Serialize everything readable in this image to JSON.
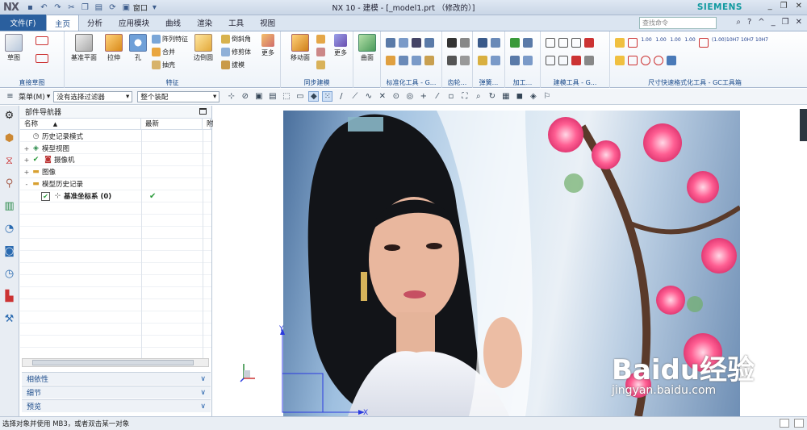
{
  "app": {
    "logo": "NX",
    "title": "NX 10 - 建模 - [_model1.prt （修改的）]",
    "brand": "SIEMENS",
    "window_menu": "窗口"
  },
  "ribbon_tabs": {
    "file": "文件(F)",
    "items": [
      "主页",
      "分析",
      "应用模块",
      "曲线",
      "渲染",
      "工具",
      "视图"
    ],
    "active": "主页",
    "search_placeholder": "查找命令"
  },
  "ribbon": {
    "direct_sketch": {
      "label": "直接草图",
      "sketch": "草图"
    },
    "feature": {
      "label": "特征",
      "datum_plane": "基准平面",
      "extrude": "拉伸",
      "hole": "孔",
      "pattern": "阵列特征",
      "unite": "合并",
      "shell": "抽壳",
      "edge_blend": "边倒圆",
      "chamfer": "倒斜角",
      "trim_body": "修剪体",
      "draft": "拔模",
      "more": "更多"
    },
    "sync": {
      "label": "同步建模",
      "move_face": "移动面",
      "more": "更多"
    },
    "surface": {
      "label": "",
      "surface": "曲面"
    },
    "group_labels": [
      "标准化工具 - G...",
      "齿轮...",
      "弹簧...",
      "加工...",
      "建模工具 - G...",
      "尺寸快速格式化工具 - GC工具箱"
    ]
  },
  "toolbar": {
    "menu": "菜单(M)",
    "filter": "没有选择过滤器",
    "assembly": "整个装配"
  },
  "navigator": {
    "title": "部件导航器",
    "columns": {
      "name": "名称",
      "latest": "最新",
      "extra": "附"
    },
    "rows": [
      {
        "name": "历史记录模式",
        "expand": "",
        "latest": ""
      },
      {
        "name": "模型视图",
        "expand": "+",
        "latest": ""
      },
      {
        "name": "摄像机",
        "expand": "+",
        "latest": ""
      },
      {
        "name": "图像",
        "expand": "+",
        "latest": ""
      },
      {
        "name": "模型历史记录",
        "expand": "-",
        "latest": ""
      },
      {
        "name": "基准坐标系 (0)",
        "expand": "",
        "latest": "✔"
      }
    ],
    "panels": [
      "相依性",
      "细节",
      "预览"
    ]
  },
  "graphics": {
    "axis_x": "X",
    "axis_y": "Y",
    "watermark_brand": "Baidu经验",
    "watermark_url": "jingyan.baidu.com"
  },
  "status": {
    "message": "选择对象并使用 MB3，或者双击某一对象"
  },
  "colors": {
    "file_tab": "#2a5f9e",
    "accent": "#1a4a8a",
    "brand": "#119aa0"
  }
}
